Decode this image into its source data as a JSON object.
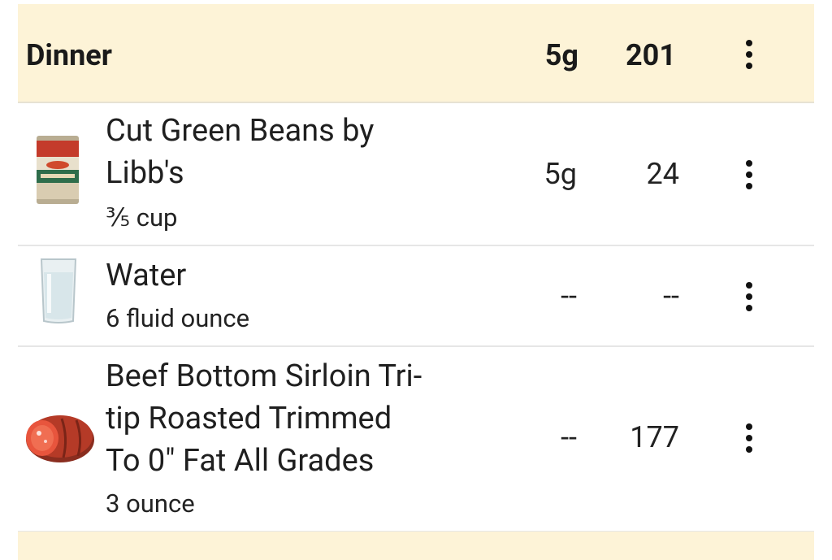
{
  "meal": {
    "title": "Dinner",
    "carbs": "5g",
    "calories": "201"
  },
  "items": [
    {
      "name_line1": "Cut Green Beans by",
      "name_line2": "Libb's",
      "serving": "⅗ cup",
      "carbs": "5g",
      "calories": "24",
      "icon": "green-beans-can-icon"
    },
    {
      "name_line1": "Water",
      "serving": "6 fluid ounce",
      "carbs": "--",
      "calories": "--",
      "icon": "water-glass-icon"
    },
    {
      "name_line1": "Beef Bottom Sirloin Tri-",
      "name_line2": "tip Roasted Trimmed",
      "name_line3": "To 0\" Fat All Grades",
      "serving": "3 ounce",
      "carbs": "--",
      "calories": "177",
      "icon": "beef-roast-icon"
    }
  ],
  "colors": {
    "header_bg": "#fdf3d7",
    "divider": "#e6e6e6"
  }
}
